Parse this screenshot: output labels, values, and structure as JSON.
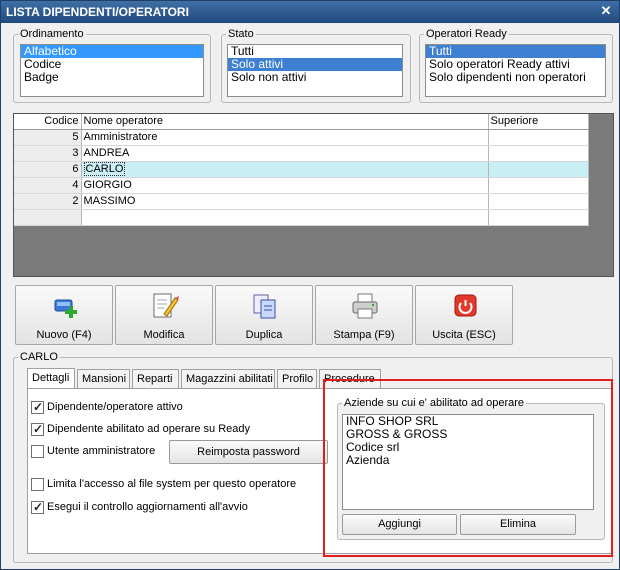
{
  "window": {
    "title": "LISTA DIPENDENTI/OPERATORI",
    "close_glyph": "✕"
  },
  "filters": {
    "ordinamento": {
      "legend": "Ordinamento",
      "options": [
        "Alfabetico",
        "Codice",
        "Badge"
      ],
      "selected": "Alfabetico"
    },
    "stato": {
      "legend": "Stato",
      "options": [
        "Tutti",
        "Solo attivi",
        "Solo non attivi"
      ],
      "selected": "Solo attivi"
    },
    "ready": {
      "legend": "Operatori Ready",
      "options": [
        "Tutti",
        "Solo operatori Ready attivi",
        "Solo dipendenti non operatori"
      ],
      "selected": "Tutti"
    }
  },
  "grid": {
    "headers": {
      "codice": "Codice",
      "nome": "Nome operatore",
      "superiore": "Superiore"
    },
    "rows": [
      {
        "codice": "5",
        "nome": "Amministratore",
        "superiore": ""
      },
      {
        "codice": "3",
        "nome": "ANDREA",
        "superiore": ""
      },
      {
        "codice": "6",
        "nome": "CARLO",
        "superiore": "",
        "current": true
      },
      {
        "codice": "4",
        "nome": "GIORGIO",
        "superiore": ""
      },
      {
        "codice": "2",
        "nome": "MASSIMO",
        "superiore": ""
      }
    ]
  },
  "toolbar": {
    "nuovo": "Nuovo (F4)",
    "modifica": "Modifica",
    "duplica": "Duplica",
    "stampa": "Stampa (F9)",
    "uscita": "Uscita (ESC)"
  },
  "detail": {
    "legend": "CARLO",
    "tabs": [
      "Dettagli",
      "Mansioni",
      "Reparti",
      "Magazzini abilitati",
      "Profilo",
      "Procedure"
    ],
    "active_tab": "Dettagli",
    "checkboxes": {
      "attivo": {
        "label": "Dipendente/operatore attivo",
        "checked": true
      },
      "ready": {
        "label": "Dipendente abilitato ad operare su Ready",
        "checked": true
      },
      "admin": {
        "label": "Utente amministratore",
        "checked": false
      },
      "fs": {
        "label": "Limita l'accesso al file system per questo operatore",
        "checked": false
      },
      "update": {
        "label": "Esegui il controllo aggiornamenti all'avvio",
        "checked": true
      }
    },
    "reset_password": "Reimposta password",
    "aziende": {
      "legend": "Aziende su cui e' abilitato ad operare",
      "items": [
        "INFO SHOP SRL",
        "GROSS & GROSS",
        "Codice srl",
        "Azienda"
      ],
      "add": "Aggiungi",
      "remove": "Elimina"
    }
  },
  "colors": {
    "title_bar": "#21497d",
    "selection": "#3399ff",
    "current_row": "#c9eef3",
    "highlight_frame": "#e02020"
  }
}
